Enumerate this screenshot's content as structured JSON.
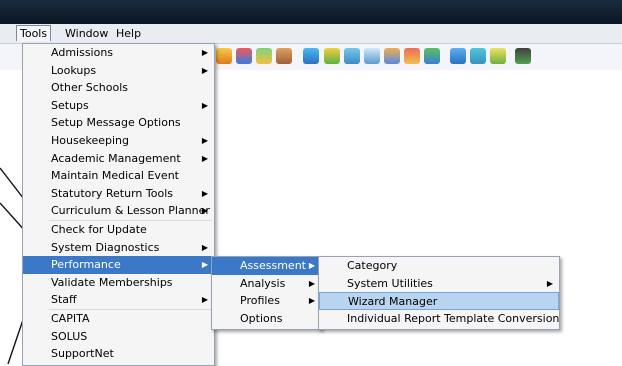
{
  "menubar": {
    "items": [
      {
        "label": "Tools",
        "hotkey": "T",
        "rest": "ools"
      },
      {
        "label": "Window",
        "hotkey": "W",
        "rest": "indow"
      },
      {
        "label": "Help",
        "hotkey": "H",
        "rest": "elp"
      }
    ]
  },
  "tools_menu": {
    "items": [
      {
        "label": "Admissions",
        "submenu": true
      },
      {
        "label": "Lookups",
        "submenu": true
      },
      {
        "label": "Other Schools",
        "submenu": false
      },
      {
        "label": "Setups",
        "submenu": true
      },
      {
        "label": "Setup Message Options",
        "submenu": false
      },
      {
        "label": "Housekeeping",
        "submenu": true
      },
      {
        "label": "Academic Management",
        "submenu": true
      },
      {
        "label": "Maintain Medical Event",
        "submenu": false
      },
      {
        "label": "Statutory Return Tools",
        "submenu": true
      },
      {
        "label": "Curriculum & Lesson Planner",
        "submenu": true
      },
      {
        "label": "Check for Update",
        "submenu": false
      },
      {
        "label": "System Diagnostics",
        "submenu": true
      },
      {
        "label": "Performance",
        "submenu": true
      },
      {
        "label": "Validate Memberships",
        "submenu": false
      },
      {
        "label": "Staff",
        "submenu": true
      },
      {
        "label": "CAPITA",
        "submenu": false
      },
      {
        "label": "SOLUS",
        "submenu": false
      },
      {
        "label": "SupportNet",
        "submenu": false
      }
    ]
  },
  "performance_menu": {
    "items": [
      {
        "label": "Assessment",
        "submenu": true
      },
      {
        "label": "Analysis",
        "submenu": true
      },
      {
        "label": "Profiles",
        "submenu": true
      },
      {
        "label": "Options",
        "submenu": false
      }
    ]
  },
  "assessment_menu": {
    "items": [
      {
        "label": "Category",
        "submenu": false
      },
      {
        "label": "System Utilities",
        "submenu": true
      },
      {
        "label": "Wizard Manager",
        "submenu": false
      },
      {
        "label": "Individual Report Template Conversion",
        "submenu": false
      }
    ]
  },
  "submenu_arrow": "▶",
  "colors": {
    "highlight": "#3c78c8",
    "highlight_light": "#b8d4f0",
    "menu_bg": "#f5f5f5",
    "titlebar": "#0b1624"
  }
}
